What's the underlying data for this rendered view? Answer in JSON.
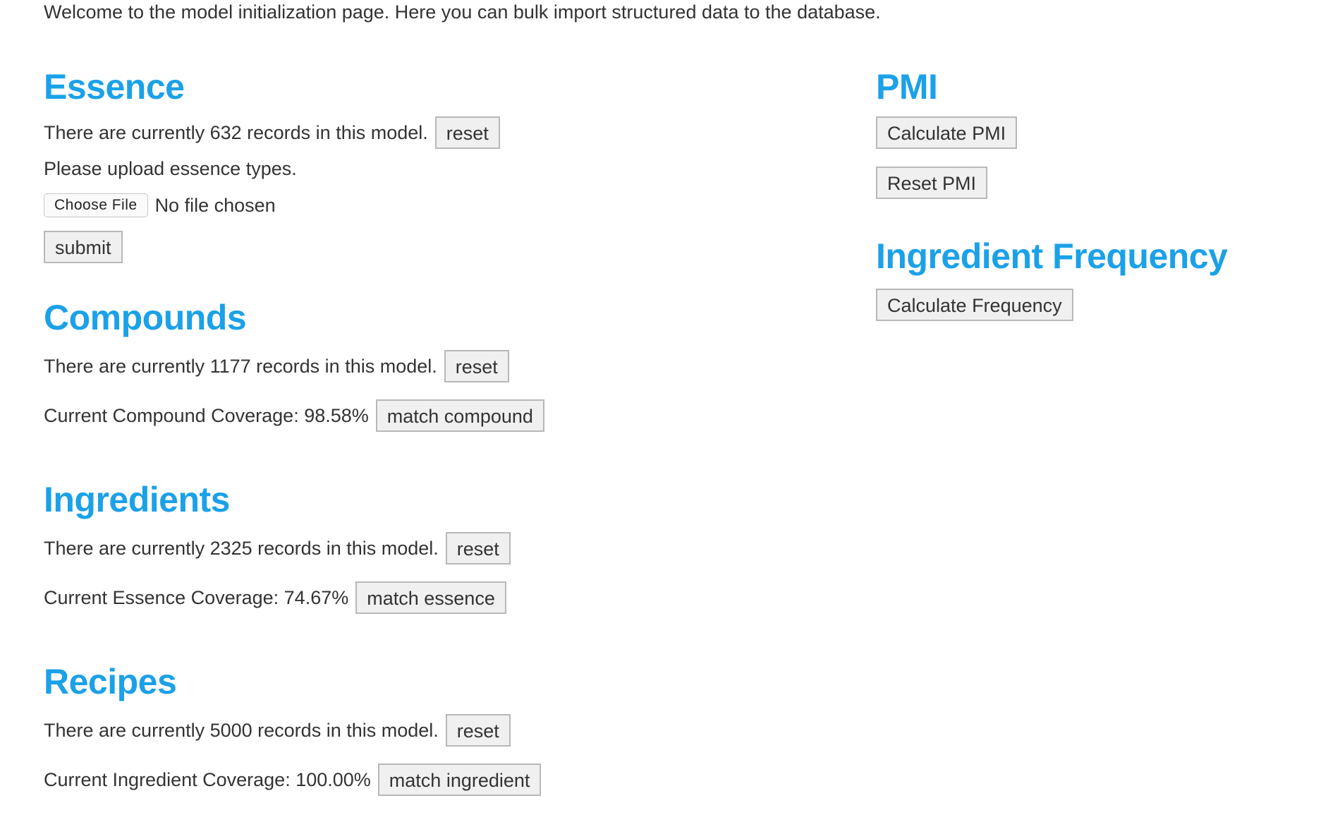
{
  "welcome_text": "Welcome to the model initialization page. Here you can bulk import structured data to the database.",
  "accent_color": "#1ba1e8",
  "essence": {
    "title": "Essence",
    "records_text": "There are currently 632 records in this model.",
    "reset_label": "reset",
    "upload_prompt": "Please upload essence types.",
    "choose_file_label": "Choose File",
    "file_status": "No file chosen",
    "submit_label": "submit"
  },
  "compounds": {
    "title": "Compounds",
    "records_text": "There are currently 1177 records in this model.",
    "reset_label": "reset",
    "coverage_text": "Current Compound Coverage: 98.58%",
    "match_label": "match compound"
  },
  "ingredients": {
    "title": "Ingredients",
    "records_text": "There are currently 2325 records in this model.",
    "reset_label": "reset",
    "coverage_text": "Current Essence Coverage: 74.67%",
    "match_label": "match essence"
  },
  "recipes": {
    "title": "Recipes",
    "records_text": "There are currently 5000 records in this model.",
    "reset_label": "reset",
    "coverage_text": "Current Ingredient Coverage: 100.00%",
    "match_label": "match ingredient"
  },
  "pmi": {
    "title": "PMI",
    "calculate_label": "Calculate PMI",
    "reset_label": "Reset PMI"
  },
  "frequency": {
    "title": "Ingredient Frequency",
    "calculate_label": "Calculate Frequency"
  }
}
